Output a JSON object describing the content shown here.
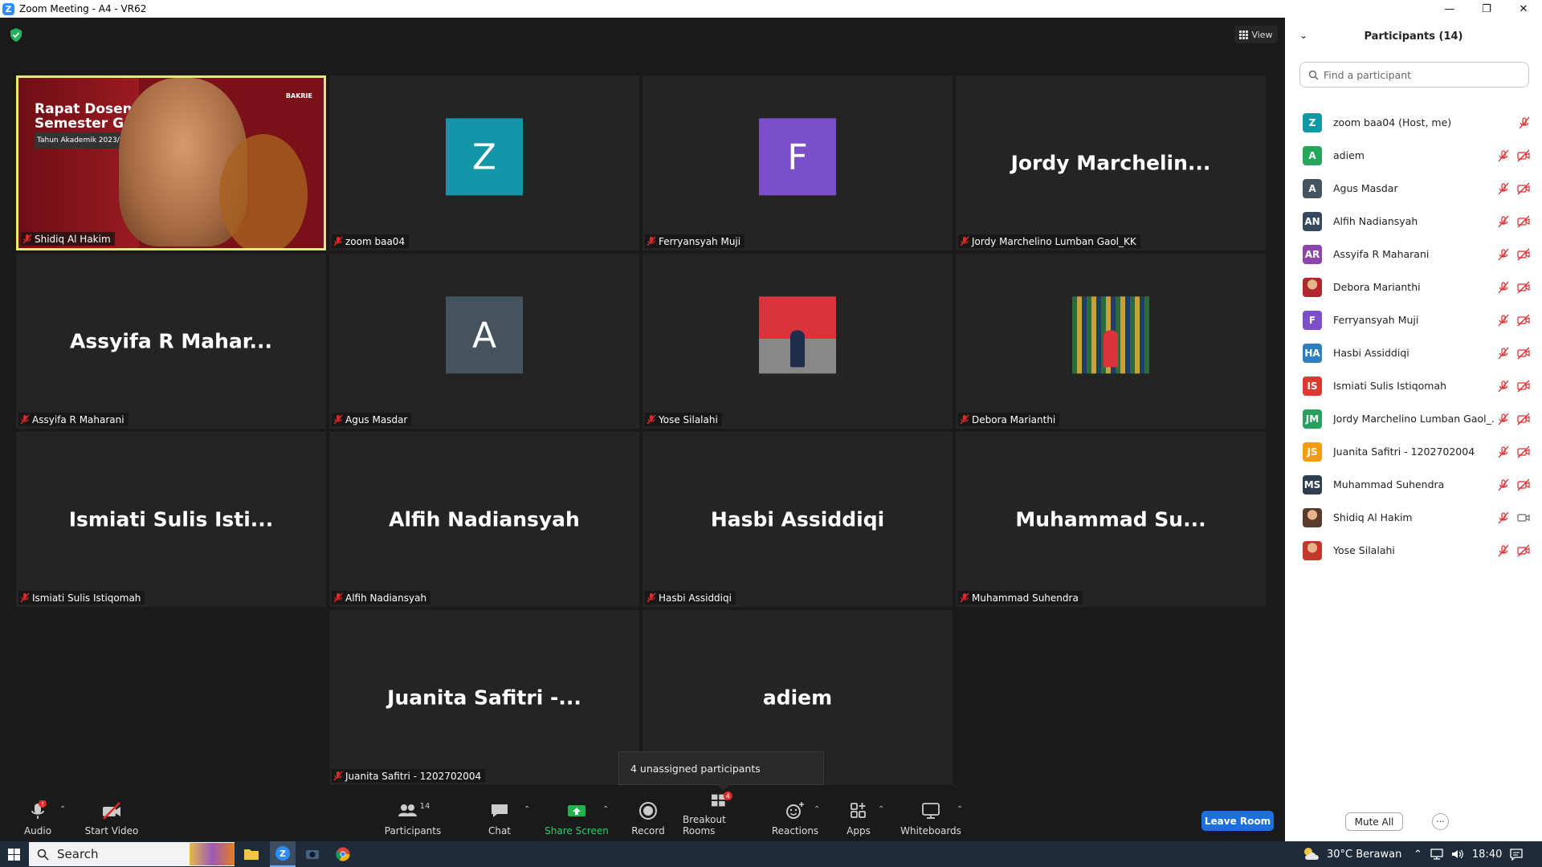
{
  "window": {
    "title": "Zoom Meeting - A4 - VR62"
  },
  "view_label": "View",
  "tiles": [
    {
      "name": "Shidiq Al Hakim",
      "type": "video",
      "slide_title_1": "Rapat Dosen",
      "slide_title_2": "Semester Ga",
      "slide_sub": "Tahun Akademik 2023/2",
      "slide_logo": "BAKRIE"
    },
    {
      "name": "zoom baa04",
      "type": "avatar",
      "letter": "Z",
      "color": "#1296a8"
    },
    {
      "name": "Ferryansyah Muji",
      "type": "avatar",
      "letter": "F",
      "color": "#7b4fc9"
    },
    {
      "name": "Jordy Marchelino Lumban Gaol_KK",
      "type": "text",
      "big": "Jordy  Marchelin..."
    },
    {
      "name": "Assyifa R Maharani",
      "type": "text",
      "big": "Assyifa  R  Mahar..."
    },
    {
      "name": "Agus Masdar",
      "type": "avatar",
      "letter": "A",
      "color": "#45535e"
    },
    {
      "name": "Yose Silalahi",
      "type": "photo"
    },
    {
      "name": "Debora Marianthi",
      "type": "photo"
    },
    {
      "name": "Ismiati Sulis Istiqomah",
      "type": "text",
      "big": "Ismiati  Sulis  Isti..."
    },
    {
      "name": "Alfih Nadiansyah",
      "type": "text",
      "big": "Alfih  Nadiansyah"
    },
    {
      "name": "Hasbi Assiddiqi",
      "type": "text",
      "big": "Hasbi  Assiddiqi"
    },
    {
      "name": "Muhammad Suhendra",
      "type": "text",
      "big": "Muhammad  Su..."
    },
    {
      "name": "Juanita Safitri - 1202702004",
      "type": "text",
      "big": "Juanita  Safitri  -..."
    },
    {
      "name": "",
      "type": "text",
      "big": "adiem"
    }
  ],
  "tooltip": "4 unassigned participants",
  "toolbar": {
    "audio": "Audio",
    "audio_badge": "!",
    "start_video": "Start Video",
    "participants": "Participants",
    "participants_count": "14",
    "chat": "Chat",
    "share_screen": "Share Screen",
    "record": "Record",
    "breakout_rooms": "Breakout Rooms",
    "breakout_badge": "4",
    "reactions": "Reactions",
    "apps": "Apps",
    "whiteboards": "Whiteboards",
    "leave_room": "Leave Room"
  },
  "panel": {
    "title": "Participants (14)",
    "search_placeholder": "Find a participant",
    "mute_all": "Mute All",
    "more": "···",
    "participants": [
      {
        "name": "zoom baa04 (Host, me)",
        "initials": "Z",
        "color": "#1296a8",
        "video": "none"
      },
      {
        "name": "adiem",
        "initials": "A",
        "color": "#26a65b",
        "video": "off"
      },
      {
        "name": "Agus Masdar",
        "initials": "A",
        "color": "#45535e",
        "video": "off"
      },
      {
        "name": "Alfih Nadiansyah",
        "initials": "AN",
        "color": "#34495e",
        "video": "off"
      },
      {
        "name": "Assyifa R Maharani",
        "initials": "AR",
        "color": "#8e44ad",
        "video": "off"
      },
      {
        "name": "Debora Marianthi",
        "initials": "",
        "color": "#b0282f",
        "video": "off"
      },
      {
        "name": "Ferryansyah Muji",
        "initials": "F",
        "color": "#7b4fc9",
        "video": "off"
      },
      {
        "name": "Hasbi Assiddiqi",
        "initials": "HA",
        "color": "#2d7fc1",
        "video": "off"
      },
      {
        "name": "Ismiati Sulis Istiqomah",
        "initials": "IS",
        "color": "#d63c2f",
        "video": "off"
      },
      {
        "name": "Jordy Marchelino Lumban Gaol_...",
        "initials": "JM",
        "color": "#27a25c",
        "video": "off"
      },
      {
        "name": "Juanita Safitri - 1202702004",
        "initials": "JS",
        "color": "#f39c12",
        "video": "off"
      },
      {
        "name": "Muhammad Suhendra",
        "initials": "MS",
        "color": "#2c3e50",
        "video": "off"
      },
      {
        "name": "Shidiq Al Hakim",
        "initials": "",
        "color": "#5a3a2a",
        "video": "on"
      },
      {
        "name": "Yose Silalahi",
        "initials": "",
        "color": "#c0392b",
        "video": "off"
      }
    ]
  },
  "taskbar": {
    "search": "Search",
    "weather": "30°C  Berawan",
    "time": "18:40"
  }
}
